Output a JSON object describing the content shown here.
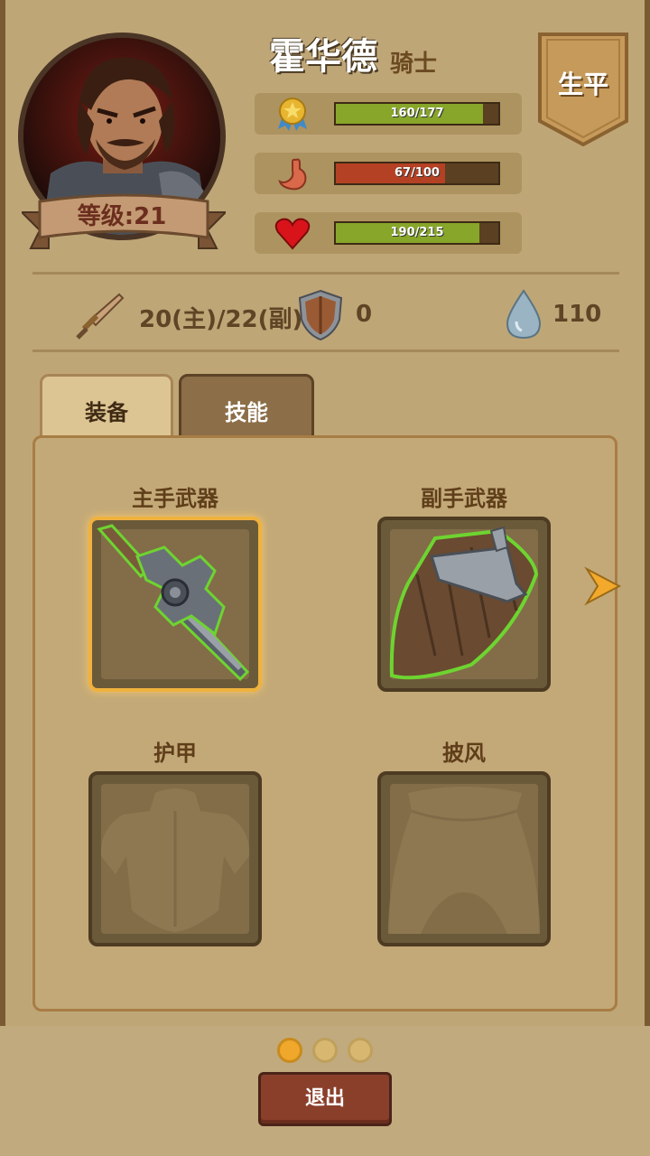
{
  "hero": {
    "name": "霍华德",
    "class": "骑士",
    "level_label": "等级:21"
  },
  "stats": [
    {
      "icon": "medal-icon",
      "text": "160/177",
      "value": 160,
      "max": 177,
      "color": "#87a62a"
    },
    {
      "icon": "stomach-icon",
      "text": "67/100",
      "value": 67,
      "max": 100,
      "color": "#b54124"
    },
    {
      "icon": "heart-icon",
      "text": "190/215",
      "value": 190,
      "max": 215,
      "color": "#87a62a"
    }
  ],
  "career_button": "生平",
  "attributes": {
    "attack": "20(主)/22(副)",
    "defense": "0",
    "water": "110"
  },
  "tabs": {
    "equipment": "装备",
    "skills": "技能"
  },
  "slots": {
    "main_weapon": "主手武器",
    "off_weapon": "副手武器",
    "armor": "护甲",
    "cloak": "披风"
  },
  "pagination": {
    "current": 1,
    "total": 3
  },
  "exit_button": "退出"
}
